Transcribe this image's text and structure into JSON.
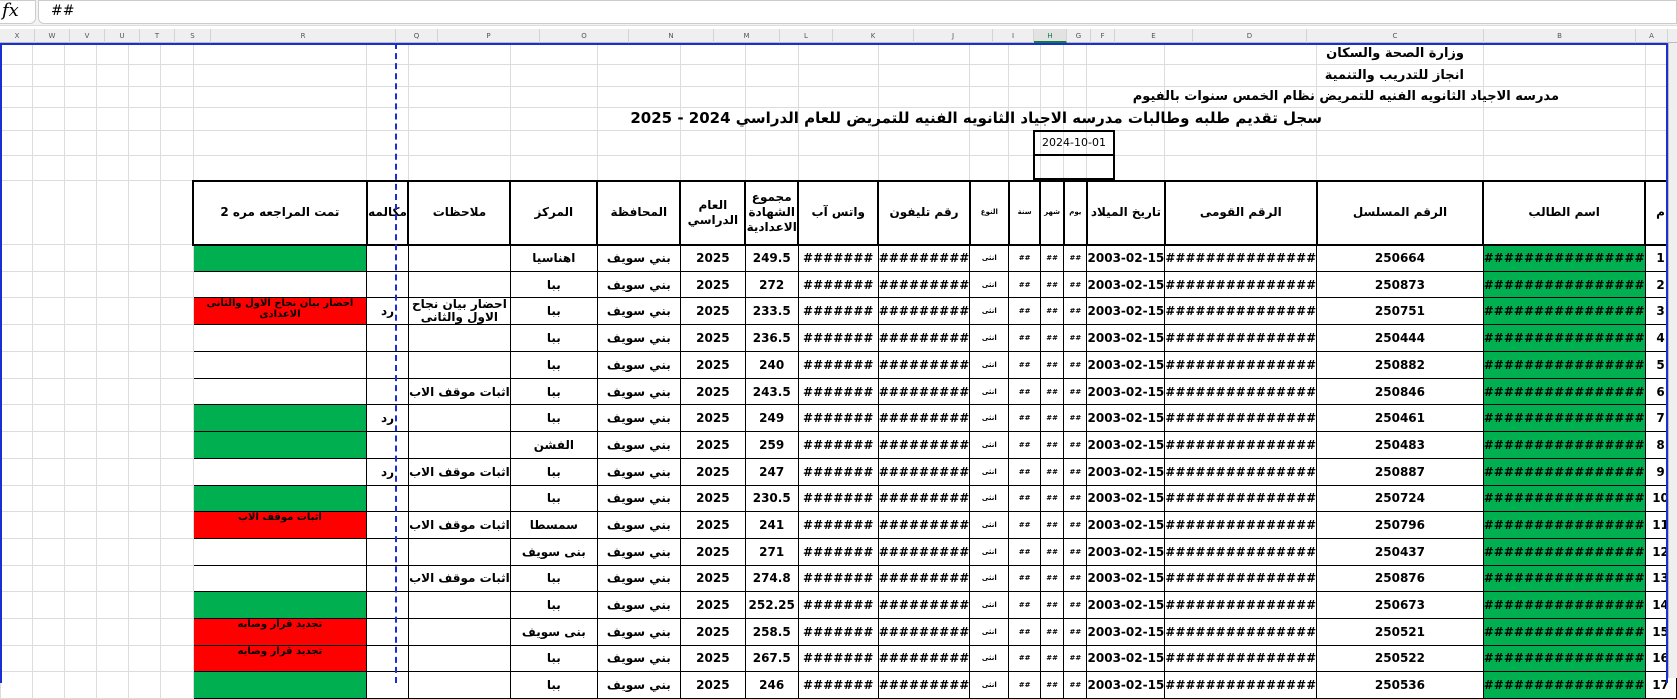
{
  "formula_bar": {
    "fx_label": "fx",
    "value": "##"
  },
  "columns": [
    "X",
    "W",
    "V",
    "U",
    "T",
    "S",
    "R",
    "Q",
    "P",
    "O",
    "N",
    "M",
    "L",
    "K",
    "J",
    "I",
    "H",
    "G",
    "F",
    "E",
    "D",
    "C",
    "B",
    "A"
  ],
  "selected_column": "H",
  "header": {
    "line1": "وزارة الصحة والسكان",
    "line2": "انجاز للتدريب والتنمية",
    "line3": "مدرسه  الاجياد الثانويه  الفنيه للتمريض نظام الخمس سنوات بالفيوم",
    "title": "سجل تقديم طلبه وطالبات  مدرسه  الاجياد الثانويه  الفنيه للتمريض للعام الدراسي 2024 - 2025",
    "date": "2024-10-01"
  },
  "table_headers": {
    "R": "تمت المراجعه مره 2",
    "Q": "مكالمه",
    "P": "ملاحظات",
    "O": "المركز",
    "N": "المحافظة",
    "M": "العام الدراسي",
    "L": "مجموع الشهادة الاعدادية",
    "K": "واتس آب",
    "J": "رقم تليفون",
    "I": "النوع",
    "H": "سنة",
    "G": "شهر",
    "F": "يوم",
    "E": "تاريخ الميلاد",
    "D": "الرقم القومى",
    "C": "الرقم المسلسل",
    "B": "اسم الطالب",
    "A": "م"
  },
  "colors": {
    "green": "#00b050",
    "red": "#ff0000",
    "print_area": "#1a2fd0"
  },
  "rows": [
    {
      "A": "1",
      "B": "################",
      "C": "250664",
      "D": "###############",
      "E": "2003-02-15",
      "F": "##",
      "G": "##",
      "H": "##",
      "I": "انثى",
      "J": "#########",
      "K": "#######",
      "L": "249.5",
      "M": "2025",
      "N": "بني سويف",
      "O": "اهناسيا",
      "P": "",
      "Q": "",
      "R": "",
      "status": "green"
    },
    {
      "A": "2",
      "B": "################",
      "C": "250873",
      "D": "###############",
      "E": "2003-02-15",
      "F": "##",
      "G": "##",
      "H": "##",
      "I": "انثى",
      "J": "#########",
      "K": "#######",
      "L": "272",
      "M": "2025",
      "N": "بني سويف",
      "O": "ببا",
      "P": "",
      "Q": "",
      "R": "",
      "status": "white"
    },
    {
      "A": "3",
      "B": "################",
      "C": "250751",
      "D": "###############",
      "E": "2003-02-15",
      "F": "##",
      "G": "##",
      "H": "##",
      "I": "انثى",
      "J": "#########",
      "K": "#######",
      "L": "233.5",
      "M": "2025",
      "N": "بني سويف",
      "O": "ببا",
      "P": "احضار بيان نجاح الاول والثانى",
      "Q": "رد",
      "R": "احضار بيان نجاح الاول والثانى الاعدادى",
      "status": "red"
    },
    {
      "A": "4",
      "B": "################",
      "C": "250444",
      "D": "###############",
      "E": "2003-02-15",
      "F": "##",
      "G": "##",
      "H": "##",
      "I": "انثى",
      "J": "#########",
      "K": "#######",
      "L": "236.5",
      "M": "2025",
      "N": "بني سويف",
      "O": "ببا",
      "P": "",
      "Q": "",
      "R": "",
      "status": "white"
    },
    {
      "A": "5",
      "B": "################",
      "C": "250882",
      "D": "###############",
      "E": "2003-02-15",
      "F": "##",
      "G": "##",
      "H": "##",
      "I": "انثى",
      "J": "#########",
      "K": "#######",
      "L": "240",
      "M": "2025",
      "N": "بني سويف",
      "O": "ببا",
      "P": "",
      "Q": "",
      "R": "",
      "status": "white"
    },
    {
      "A": "6",
      "B": "################",
      "C": "250846",
      "D": "###############",
      "E": "2003-02-15",
      "F": "##",
      "G": "##",
      "H": "##",
      "I": "انثى",
      "J": "#########",
      "K": "#######",
      "L": "243.5",
      "M": "2025",
      "N": "بني سويف",
      "O": "ببا",
      "P": "اثبات موقف الاب",
      "Q": "",
      "R": "",
      "status": "white"
    },
    {
      "A": "7",
      "B": "################",
      "C": "250461",
      "D": "###############",
      "E": "2003-02-15",
      "F": "##",
      "G": "##",
      "H": "##",
      "I": "انثى",
      "J": "#########",
      "K": "#######",
      "L": "249",
      "M": "2025",
      "N": "بني سويف",
      "O": "ببا",
      "P": "",
      "Q": "رد",
      "R": "",
      "status": "green"
    },
    {
      "A": "8",
      "B": "################",
      "C": "250483",
      "D": "###############",
      "E": "2003-02-15",
      "F": "##",
      "G": "##",
      "H": "##",
      "I": "انثى",
      "J": "#########",
      "K": "#######",
      "L": "259",
      "M": "2025",
      "N": "بني سويف",
      "O": "الفشن",
      "P": "",
      "Q": "",
      "R": "",
      "status": "green"
    },
    {
      "A": "9",
      "B": "################",
      "C": "250887",
      "D": "###############",
      "E": "2003-02-15",
      "F": "##",
      "G": "##",
      "H": "##",
      "I": "انثى",
      "J": "#########",
      "K": "#######",
      "L": "247",
      "M": "2025",
      "N": "بني سويف",
      "O": "ببا",
      "P": "اثبات موقف الاب",
      "Q": "رد",
      "R": "",
      "status": "white"
    },
    {
      "A": "10",
      "B": "################",
      "C": "250724",
      "D": "###############",
      "E": "2003-02-15",
      "F": "##",
      "G": "##",
      "H": "##",
      "I": "انثى",
      "J": "#########",
      "K": "#######",
      "L": "230.5",
      "M": "2025",
      "N": "بني سويف",
      "O": "ببا",
      "P": "",
      "Q": "",
      "R": "",
      "status": "green"
    },
    {
      "A": "11",
      "B": "################",
      "C": "250796",
      "D": "###############",
      "E": "2003-02-15",
      "F": "##",
      "G": "##",
      "H": "##",
      "I": "انثى",
      "J": "#########",
      "K": "#######",
      "L": "241",
      "M": "2025",
      "N": "بني سويف",
      "O": "سمسطا",
      "P": "اثبات موقف الاب",
      "Q": "",
      "R": "اثبات موقف الاب",
      "status": "red"
    },
    {
      "A": "12",
      "B": "################",
      "C": "250437",
      "D": "###############",
      "E": "2003-02-15",
      "F": "##",
      "G": "##",
      "H": "##",
      "I": "انثى",
      "J": "#########",
      "K": "#######",
      "L": "271",
      "M": "2025",
      "N": "بني سويف",
      "O": "بنى سويف",
      "P": "",
      "Q": "",
      "R": "",
      "status": "white"
    },
    {
      "A": "13",
      "B": "################",
      "C": "250876",
      "D": "###############",
      "E": "2003-02-15",
      "F": "##",
      "G": "##",
      "H": "##",
      "I": "انثى",
      "J": "#########",
      "K": "#######",
      "L": "274.8",
      "M": "2025",
      "N": "بني سويف",
      "O": "ببا",
      "P": "اثبات موقف الاب",
      "Q": "",
      "R": "",
      "status": "white"
    },
    {
      "A": "14",
      "B": "################",
      "C": "250673",
      "D": "###############",
      "E": "2003-02-15",
      "F": "##",
      "G": "##",
      "H": "##",
      "I": "انثى",
      "J": "#########",
      "K": "#######",
      "L": "252.25",
      "M": "2025",
      "N": "بني سويف",
      "O": "ببا",
      "P": "",
      "Q": "",
      "R": "",
      "status": "green"
    },
    {
      "A": "15",
      "B": "################",
      "C": "250521",
      "D": "###############",
      "E": "2003-02-15",
      "F": "##",
      "G": "##",
      "H": "##",
      "I": "انثى",
      "J": "#########",
      "K": "#######",
      "L": "258.5",
      "M": "2025",
      "N": "بني سويف",
      "O": "بنى سويف",
      "P": "",
      "Q": "",
      "R": "تجديد قرار وصايه",
      "status": "red"
    },
    {
      "A": "16",
      "B": "################",
      "C": "250522",
      "D": "###############",
      "E": "2003-02-15",
      "F": "##",
      "G": "##",
      "H": "##",
      "I": "انثى",
      "J": "#########",
      "K": "#######",
      "L": "267.5",
      "M": "2025",
      "N": "بني سويف",
      "O": "ببا",
      "P": "",
      "Q": "",
      "R": "تجديد قرار وصايه",
      "status": "red"
    },
    {
      "A": "17",
      "B": "################",
      "C": "250536",
      "D": "###############",
      "E": "2003-02-15",
      "F": "##",
      "G": "##",
      "H": "##",
      "I": "انثى",
      "J": "#########",
      "K": "#######",
      "L": "246",
      "M": "2025",
      "N": "بني سويف",
      "O": "ببا",
      "P": "",
      "Q": "",
      "R": "",
      "status": "green"
    }
  ]
}
